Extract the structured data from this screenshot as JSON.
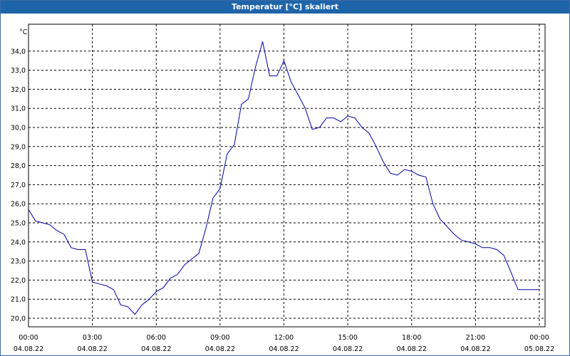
{
  "window": {
    "title": "Temperatur [°C] skaliert"
  },
  "chart_data": {
    "type": "line",
    "title": "Temperatur [°C] skaliert",
    "ylabel": "°C",
    "ylim": [
      20.0,
      35.0
    ],
    "yticks": [
      "20,0",
      "21,0",
      "22,0",
      "23,0",
      "24,0",
      "25,0",
      "26,0",
      "27,0",
      "28,0",
      "29,0",
      "30,0",
      "31,0",
      "32,0",
      "33,0",
      "34,0"
    ],
    "xlim": [
      0,
      24
    ],
    "xticks": [
      {
        "time": "00:00",
        "date": "04.08.22",
        "hour": 0
      },
      {
        "time": "03:00",
        "date": "04.08.22",
        "hour": 3
      },
      {
        "time": "06:00",
        "date": "04.08.22",
        "hour": 6
      },
      {
        "time": "09:00",
        "date": "04.08.22",
        "hour": 9
      },
      {
        "time": "12:00",
        "date": "04.08.22",
        "hour": 12
      },
      {
        "time": "15:00",
        "date": "04.08.22",
        "hour": 15
      },
      {
        "time": "18:00",
        "date": "04.08.22",
        "hour": 18
      },
      {
        "time": "21:00",
        "date": "04.08.22",
        "hour": 21
      },
      {
        "time": "00:00",
        "date": "05.08.22",
        "hour": 24
      }
    ],
    "grid": true,
    "series": [
      {
        "color": "#0000a0",
        "x": [
          0,
          0.33,
          0.67,
          1.0,
          1.33,
          1.67,
          2.0,
          2.33,
          2.67,
          3.0,
          3.33,
          3.67,
          4.0,
          4.33,
          4.67,
          5.0,
          5.33,
          5.67,
          6.0,
          6.33,
          6.67,
          7.0,
          7.33,
          7.67,
          8.0,
          8.33,
          8.67,
          9.0,
          9.33,
          9.67,
          10.0,
          10.33,
          10.67,
          11.0,
          11.33,
          11.67,
          12.0,
          12.33,
          12.67,
          13.0,
          13.33,
          13.67,
          14.0,
          14.33,
          14.67,
          15.0,
          15.33,
          15.67,
          16.0,
          16.33,
          16.67,
          17.0,
          17.33,
          17.67,
          18.0,
          18.33,
          18.67,
          19.0,
          19.33,
          19.67,
          20.0,
          20.33,
          20.67,
          21.0,
          21.33,
          21.67,
          22.0,
          22.33,
          22.67,
          23.0,
          23.33,
          23.67,
          24.0
        ],
        "y": [
          25.7,
          25.1,
          25.0,
          24.9,
          24.6,
          24.4,
          23.7,
          23.6,
          23.6,
          21.9,
          21.8,
          21.7,
          21.5,
          20.7,
          20.6,
          20.2,
          20.7,
          21.0,
          21.4,
          21.6,
          22.1,
          22.3,
          22.8,
          23.1,
          23.4,
          24.7,
          26.3,
          26.8,
          28.6,
          29.1,
          31.2,
          31.5,
          33.2,
          34.5,
          32.7,
          32.7,
          33.5,
          32.4,
          31.7,
          31.0,
          29.9,
          30.0,
          30.5,
          30.5,
          30.3,
          30.6,
          30.5,
          30.0,
          29.7,
          29.0,
          28.2,
          27.6,
          27.5,
          27.8,
          27.7,
          27.5,
          27.4,
          26.0,
          25.2,
          24.8,
          24.4,
          24.1,
          24.0,
          23.9,
          23.7,
          23.7,
          23.6,
          23.3,
          22.4,
          21.5,
          21.5,
          21.5,
          21.5
        ]
      }
    ]
  }
}
